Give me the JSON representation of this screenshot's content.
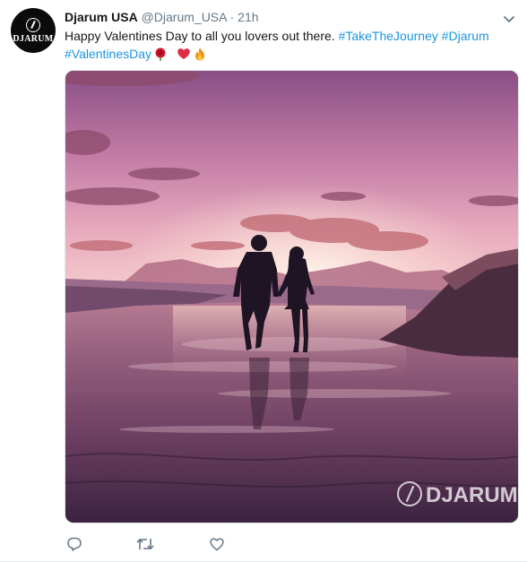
{
  "tweet": {
    "avatar_text": "DJARUM",
    "display_name": "Djarum USA",
    "handle": "@Djarum_USA",
    "separator": "·",
    "timestamp": "21h",
    "text_plain": "Happy Valentines Day to all you lovers out there. ",
    "hashtags": [
      "#TakeTheJourney",
      "#Djarum",
      "#ValentinesDay"
    ],
    "emojis": [
      "rose-emoji",
      "red-heart-emoji",
      "fire-emoji"
    ],
    "media": {
      "watermark": "DJARUM",
      "scene": "couple-silhouette-on-beach-at-sunset"
    }
  },
  "actions": {
    "icons": [
      "reply-icon",
      "retweet-icon",
      "like-icon"
    ]
  },
  "colors": {
    "link": "#1b95e0",
    "muted": "#657786",
    "text": "#14171a"
  }
}
